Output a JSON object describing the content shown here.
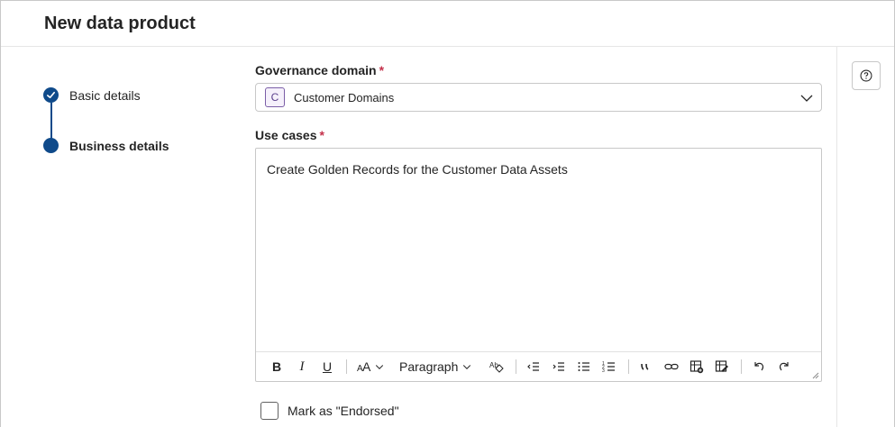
{
  "header": {
    "title": "New data product"
  },
  "stepper": {
    "steps": [
      {
        "label": "Basic details",
        "state": "completed"
      },
      {
        "label": "Business details",
        "state": "current"
      }
    ]
  },
  "form": {
    "governance_domain": {
      "label": "Governance domain",
      "required_mark": "*",
      "avatar_letter": "C",
      "value": "Customer Domains"
    },
    "use_cases": {
      "label": "Use cases",
      "required_mark": "*",
      "value": "Create Golden Records for the Customer Data Assets"
    },
    "toolbar": {
      "paragraph_label": "Paragraph",
      "bold": "B",
      "italic": "I",
      "underline": "U"
    },
    "endorsed": {
      "label": "Mark as \"Endorsed\"",
      "checked": false
    }
  },
  "colors": {
    "accent": "#0f4a8a",
    "required": "#c4314b",
    "border": "#c8c8c8"
  }
}
